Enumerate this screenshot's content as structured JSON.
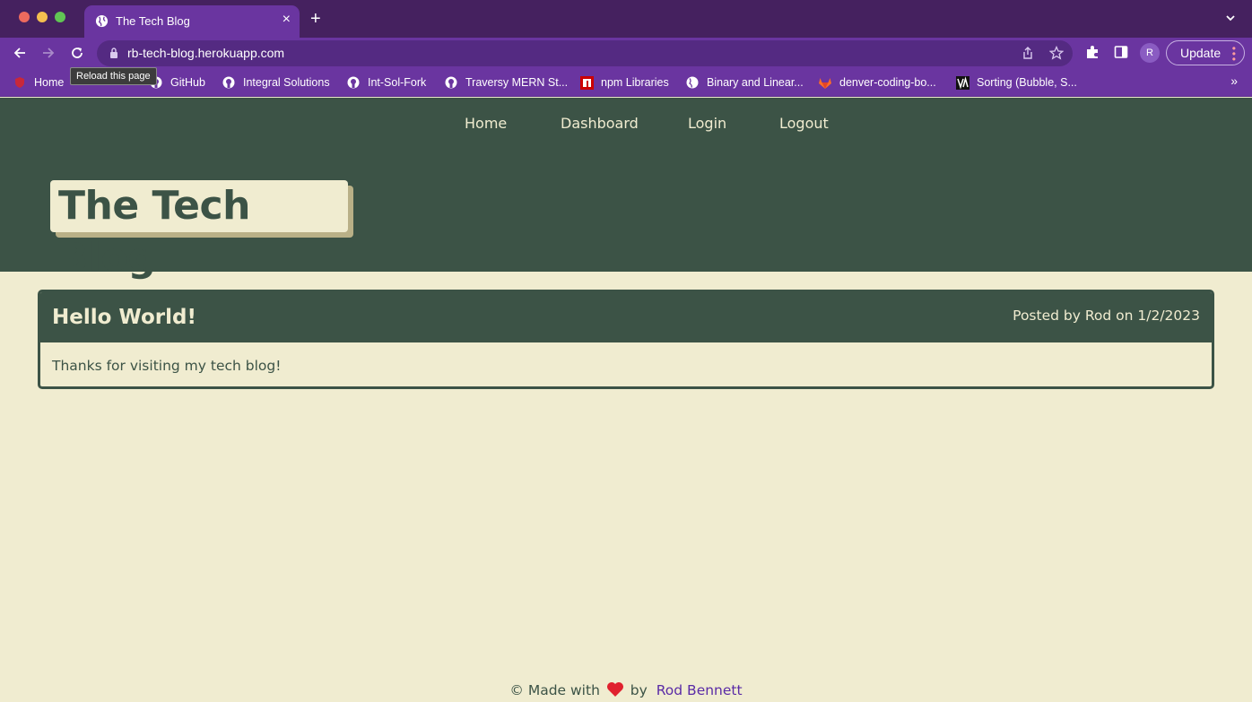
{
  "browser": {
    "tab_title": "The Tech Blog",
    "new_tab_symbol": "+",
    "close_symbol": "×",
    "url": "rb-tech-blog.herokuapp.com",
    "profile_initial": "R",
    "update_label": "Update",
    "tooltip": "Reload this page",
    "bookmarks": [
      {
        "label": "Home",
        "icon": "shield-favicon-icon"
      },
      {
        "label": "GitHub",
        "icon": "github-icon"
      },
      {
        "label": "Integral Solutions",
        "icon": "github-icon"
      },
      {
        "label": "Int-Sol-Fork",
        "icon": "github-icon"
      },
      {
        "label": "Traversy MERN St...",
        "icon": "github-icon"
      },
      {
        "label": "npm Libraries",
        "icon": "npm-icon"
      },
      {
        "label": "Binary and Linear...",
        "icon": "globe-icon"
      },
      {
        "label": "denver-coding-bo...",
        "icon": "gitlab-icon"
      },
      {
        "label": "Sorting (Bubble, S...",
        "icon": "va-icon"
      }
    ],
    "more_symbol": "»",
    "colors": {
      "tabbar": "#45215f",
      "toolbar": "#6a35a0"
    }
  },
  "site": {
    "nav": [
      "Home",
      "Dashboard",
      "Login",
      "Logout"
    ],
    "logo": "The Tech Blog",
    "colors": {
      "primary": "#3c5346",
      "background": "#f0ecd0",
      "link": "#5a2ba6"
    }
  },
  "post": {
    "title": "Hello World!",
    "meta": "Posted by Rod on 1/2/2023",
    "body": "Thanks for visiting my tech blog!"
  },
  "footer": {
    "prefix": "© Made with",
    "middle": "by",
    "author": "Rod Bennett"
  }
}
